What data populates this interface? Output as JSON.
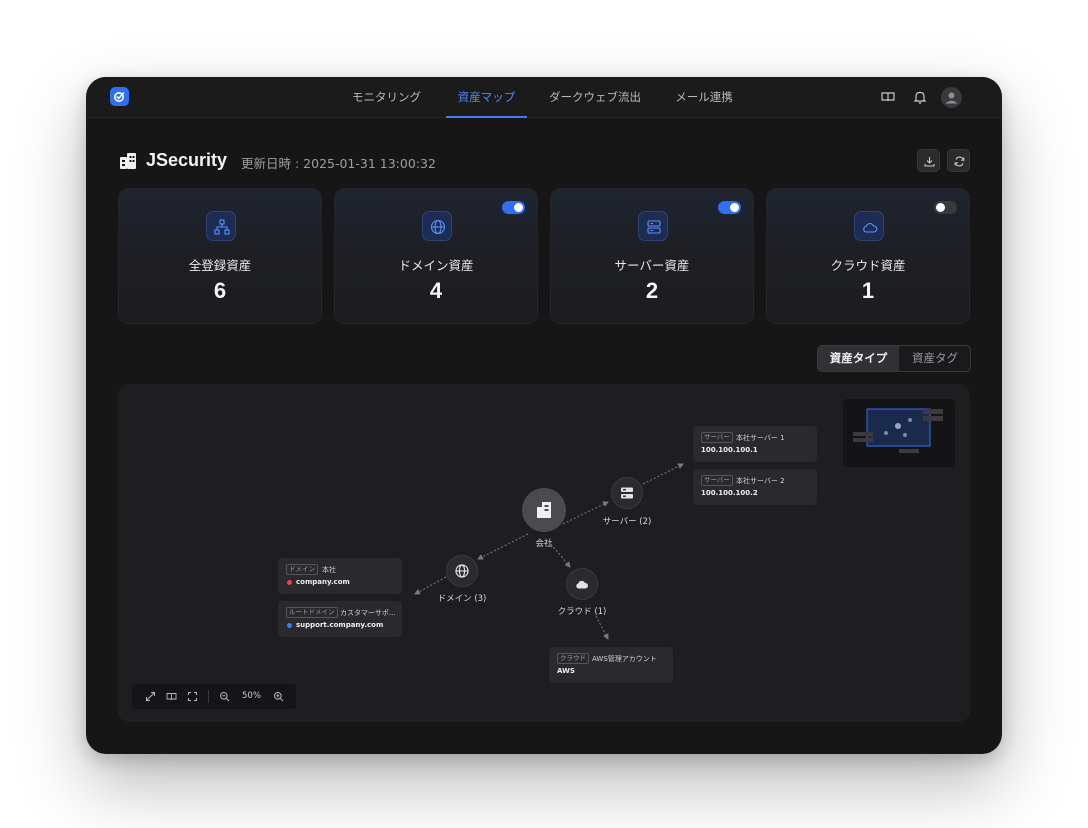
{
  "nav": {
    "tabs": [
      {
        "label": "モニタリング"
      },
      {
        "label": "資産マップ",
        "active": true
      },
      {
        "label": "ダークウェブ流出"
      },
      {
        "label": "メール連携"
      }
    ]
  },
  "header": {
    "title": "JSecurity",
    "updated": "更新日時 : 2025-01-31 13:00:32"
  },
  "cards": [
    {
      "label": "全登録資産",
      "value": "6",
      "icon": "sitemap-icon"
    },
    {
      "label": "ドメイン資産",
      "value": "4",
      "icon": "globe-icon",
      "toggle": true
    },
    {
      "label": "サーバー資産",
      "value": "2",
      "icon": "server-icon",
      "toggle": true
    },
    {
      "label": "クラウド資産",
      "value": "1",
      "icon": "cloud-icon",
      "toggle": false
    }
  ],
  "view_toggle": {
    "options": [
      "資産タイプ",
      "資産タグ"
    ],
    "selected": "資産タイプ"
  },
  "map": {
    "center": "会社",
    "groups": {
      "server": "サーバー (2)",
      "domain": "ドメイン (3)",
      "cloud": "クラウド (1)"
    },
    "assets": {
      "server1": {
        "tag": "サーバー",
        "name": "本社サーバー 1",
        "value": "100.100.100.1"
      },
      "server2": {
        "tag": "サーバー",
        "name": "本社サーバー 2",
        "value": "100.100.100.2"
      },
      "domain1": {
        "tag": "ドメイン",
        "name": "本社",
        "value": "company.com",
        "dot": "#e5484d"
      },
      "domain2": {
        "tag": "ルートドメイン",
        "name": "カスタマーサポ...",
        "value": "support.company.com",
        "dot": "#3b7bf6"
      },
      "cloud1": {
        "tag": "クラウド",
        "name": "AWS管理アカウント",
        "value": "AWS"
      }
    },
    "zoom": "50%"
  },
  "colors": {
    "accent": "#3b7bf6",
    "background": "#161617"
  }
}
